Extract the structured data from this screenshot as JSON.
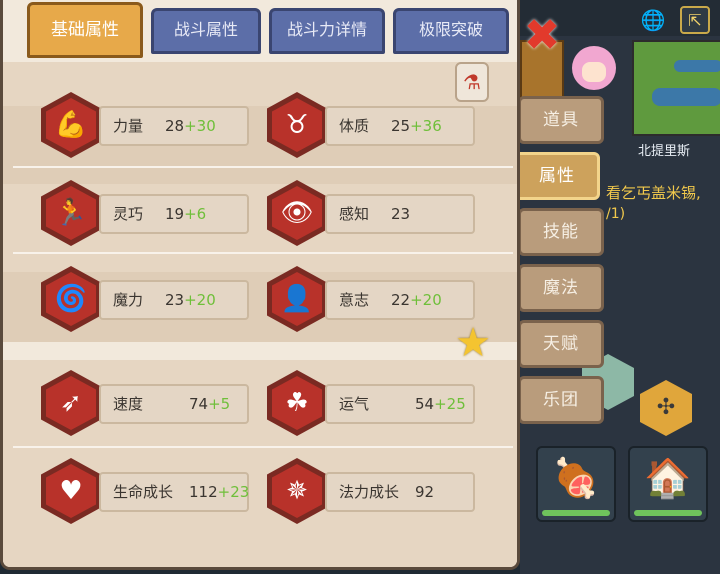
{
  "tabs": [
    {
      "label": "基础属性",
      "active": true
    },
    {
      "label": "战斗属性",
      "active": false
    },
    {
      "label": "战斗力详情",
      "active": false
    },
    {
      "label": "极限突破",
      "active": false
    }
  ],
  "stats": [
    {
      "label": "力量",
      "base": "28",
      "bonus": "+30",
      "icon": "flexed-arm-icon"
    },
    {
      "label": "体质",
      "base": "25",
      "bonus": "+36",
      "icon": "muscle-torso-icon"
    },
    {
      "label": "灵巧",
      "base": "19",
      "bonus": "+6",
      "icon": "running-figure-icon"
    },
    {
      "label": "感知",
      "base": "23",
      "bonus": "",
      "icon": "eye-icon"
    },
    {
      "label": "魔力",
      "base": "23",
      "bonus": "+20",
      "icon": "swirl-orb-icon"
    },
    {
      "label": "意志",
      "base": "22",
      "bonus": "+20",
      "icon": "head-silhouette-icon"
    },
    {
      "label": "速度",
      "base": "74",
      "bonus": "+5",
      "icon": "winged-foot-icon"
    },
    {
      "label": "运气",
      "base": "54",
      "bonus": "+25",
      "icon": "clover-icon"
    },
    {
      "label": "生命成长",
      "base": "112",
      "bonus": "+23",
      "icon": "heart-emblem-icon"
    },
    {
      "label": "法力成长",
      "base": "92",
      "bonus": "",
      "icon": "magic-sigil-icon"
    }
  ],
  "side_tabs": [
    {
      "label": "道具",
      "active": false
    },
    {
      "label": "属性",
      "active": true
    },
    {
      "label": "技能",
      "active": false
    },
    {
      "label": "魔法",
      "active": false
    },
    {
      "label": "天赋",
      "active": false
    },
    {
      "label": "乐团",
      "active": false
    }
  ],
  "background": {
    "map_label": "北提里斯",
    "quest_line": "看乞丐盖米锡,",
    "quest_progress": "/1)"
  },
  "colors": {
    "bonus": "#6fbf3a",
    "active_tab": "#e7a94a",
    "inactive_tab": "#5c6ea8",
    "stat_icon": "#b8322a"
  }
}
